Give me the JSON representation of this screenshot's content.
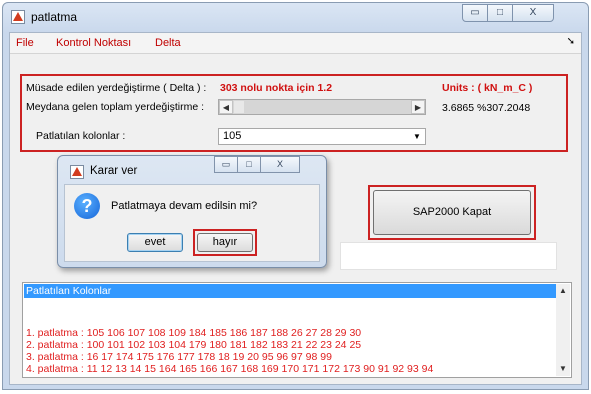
{
  "window": {
    "title": "patlatma",
    "min": "▭",
    "max": "□",
    "close": "X"
  },
  "menu": {
    "items": [
      "File",
      "Kontrol Noktası",
      "Delta"
    ],
    "arrow": "➘"
  },
  "params": {
    "delta_label": "Müsade edilen yerdeğiştirme ( Delta ) :",
    "delta_value": "303 nolu nokta için 1.2",
    "units": "Units : ( kN_m_C )",
    "total_label": "Meydana gelen toplam yerdeğiştirme :",
    "total_value": "3.6865 %307.2048",
    "cols_label": "Patlatılan kolonlar :",
    "cols_selected": "105"
  },
  "dialog": {
    "title": "Karar ver",
    "message": "Patlatmaya devam edilsin mi?",
    "yes": "evet",
    "no": "hayır"
  },
  "sap_button": "SAP2000 Kapat",
  "list": {
    "header": "Patlatılan Kolonlar",
    "rows": [
      "1. patlatma : 105 106 107 108 109 184 185 186 187 188 26 27 28 29 30",
      "2. patlatma : 100 101 102 103 104 179 180 181 182 183 21 22 23 24 25",
      "3. patlatma : 16 17 174 175 176 177 178 18 19 20 95 96 97 98 99",
      "4. patlatma : 11 12 13 14 15 164 165 166 167 168 169 170 171 172 173 90 91 92 93 94"
    ]
  }
}
